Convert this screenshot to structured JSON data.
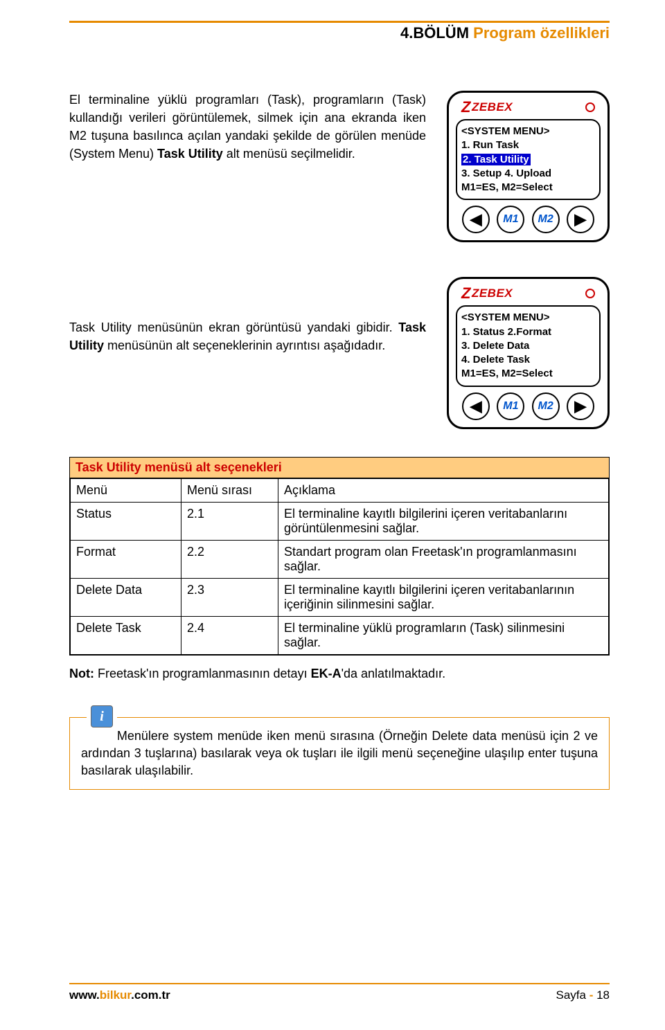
{
  "chapter": {
    "black": "4.BÖLÜM ",
    "orange": "Program özellikleri"
  },
  "para1": {
    "pre": "El terminaline yüklü programları (Task), programların (Task) kullandığı verileri görüntülemek, silmek için ana ekranda iken M2 tuşuna basılınca açılan yandaki şekilde de görülen menüde (System Menu) ",
    "bold": "Task Utility",
    "post": " alt menüsü seçilmelidir."
  },
  "para2": {
    "pre": "Task Utility menüsünün ekran görüntüsü yandaki gibidir. ",
    "bold": "Task Utility",
    "post": " menüsünün alt seçeneklerinin ayrıntısı aşağıdadır."
  },
  "device": {
    "logo": "ZEBEX",
    "screen1": {
      "title": "<SYSTEM MENU>",
      "l1": "1. Run Task",
      "l2": "2. Task Utility",
      "l3": "3. Setup 4. Upload",
      "l4": "M1=ES, M2=Select"
    },
    "screen2": {
      "title": "<SYSTEM MENU>",
      "l1": "1. Status 2.Format",
      "l2": "3. Delete Data",
      "l3": "4. Delete Task",
      "l4": "M1=ES, M2=Select"
    },
    "buttons": {
      "m1": "M1",
      "m2": "M2"
    }
  },
  "table": {
    "title": "Task Utility menüsü alt seçenekleri",
    "headers": {
      "menu": "Menü",
      "sira": "Menü sırası",
      "desc": "Açıklama"
    },
    "rows": [
      {
        "menu": "Status",
        "sira": "2.1",
        "desc": "El terminaline kayıtlı bilgilerini içeren veritabanlarını görüntülenmesini sağlar."
      },
      {
        "menu": "Format",
        "sira": "2.2",
        "desc": "Standart program olan Freetask'ın programlanmasını sağlar."
      },
      {
        "menu": "Delete Data",
        "sira": "2.3",
        "desc": "El terminaline kayıtlı bilgilerini içeren veritabanlarının içeriğinin silinmesini sağlar."
      },
      {
        "menu": "Delete Task",
        "sira": "2.4",
        "desc": "El terminaline yüklü programların (Task) silinmesini sağlar."
      }
    ]
  },
  "note": {
    "label": "Not:",
    "text": " Freetask'ın programlanmasının detayı ",
    "bold": "EK-A",
    "post": "'da anlatılmaktadır."
  },
  "info": "Menülere system menüde iken menü sırasına (Örneğin Delete data menüsü için 2 ve ardından 3 tuşlarına) basılarak veya ok tuşları ile ilgili menü seçeneğine ulaşılıp enter tuşuna basılarak ulaşılabilir.",
  "footer": {
    "url_black": "www.",
    "url_orange": "bilkur",
    "url_tail": ".com.tr",
    "page_label": "Sayfa ",
    "page_dash": "- ",
    "page_num": "18"
  }
}
